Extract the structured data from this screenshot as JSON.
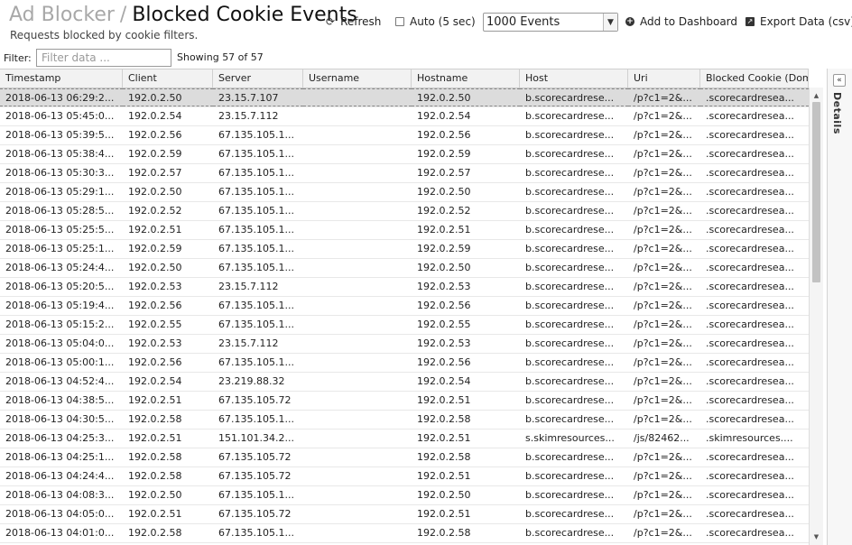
{
  "header": {
    "crumb": "Ad Blocker",
    "separator": "/",
    "title": "Blocked Cookie Events",
    "subtitle": "Requests blocked by cookie filters."
  },
  "toolbar": {
    "refresh_label": "Refresh",
    "auto_label": "Auto (5 sec)",
    "events_selected": "1000 Events",
    "add_dashboard_label": "Add to Dashboard",
    "export_label": "Export Data (csv)"
  },
  "filter": {
    "label": "Filter:",
    "placeholder": "Filter data ...",
    "showing": "Showing 57 of 57"
  },
  "columns": [
    "Timestamp",
    "Client",
    "Server",
    "Username",
    "Hostname",
    "Host",
    "Uri",
    "Blocked Cookie (Domain)"
  ],
  "rows": [
    [
      "2018-06-13 06:29:2...",
      "192.0.2.50",
      "23.15.7.107",
      "",
      "192.0.2.50",
      "b.scorecardrese...",
      "/p?c1=2&...",
      ".scorecardresea..."
    ],
    [
      "2018-06-13 05:45:0...",
      "192.0.2.54",
      "23.15.7.112",
      "",
      "192.0.2.54",
      "b.scorecardrese...",
      "/p?c1=2&...",
      ".scorecardresea..."
    ],
    [
      "2018-06-13 05:39:5...",
      "192.0.2.56",
      "67.135.105.1...",
      "",
      "192.0.2.56",
      "b.scorecardrese...",
      "/p?c1=2&...",
      ".scorecardresea..."
    ],
    [
      "2018-06-13 05:38:4...",
      "192.0.2.59",
      "67.135.105.1...",
      "",
      "192.0.2.59",
      "b.scorecardrese...",
      "/p?c1=2&...",
      ".scorecardresea..."
    ],
    [
      "2018-06-13 05:30:3...",
      "192.0.2.57",
      "67.135.105.1...",
      "",
      "192.0.2.57",
      "b.scorecardrese...",
      "/p?c1=2&...",
      ".scorecardresea..."
    ],
    [
      "2018-06-13 05:29:1...",
      "192.0.2.50",
      "67.135.105.1...",
      "",
      "192.0.2.50",
      "b.scorecardrese...",
      "/p?c1=2&...",
      ".scorecardresea..."
    ],
    [
      "2018-06-13 05:28:5...",
      "192.0.2.52",
      "67.135.105.1...",
      "",
      "192.0.2.52",
      "b.scorecardrese...",
      "/p?c1=2&...",
      ".scorecardresea..."
    ],
    [
      "2018-06-13 05:25:5...",
      "192.0.2.51",
      "67.135.105.1...",
      "",
      "192.0.2.51",
      "b.scorecardrese...",
      "/p?c1=2&...",
      ".scorecardresea..."
    ],
    [
      "2018-06-13 05:25:1...",
      "192.0.2.59",
      "67.135.105.1...",
      "",
      "192.0.2.59",
      "b.scorecardrese...",
      "/p?c1=2&...",
      ".scorecardresea..."
    ],
    [
      "2018-06-13 05:24:4...",
      "192.0.2.50",
      "67.135.105.1...",
      "",
      "192.0.2.50",
      "b.scorecardrese...",
      "/p?c1=2&...",
      ".scorecardresea..."
    ],
    [
      "2018-06-13 05:20:5...",
      "192.0.2.53",
      "23.15.7.112",
      "",
      "192.0.2.53",
      "b.scorecardrese...",
      "/p?c1=2&...",
      ".scorecardresea..."
    ],
    [
      "2018-06-13 05:19:4...",
      "192.0.2.56",
      "67.135.105.1...",
      "",
      "192.0.2.56",
      "b.scorecardrese...",
      "/p?c1=2&...",
      ".scorecardresea..."
    ],
    [
      "2018-06-13 05:15:2...",
      "192.0.2.55",
      "67.135.105.1...",
      "",
      "192.0.2.55",
      "b.scorecardrese...",
      "/p?c1=2&...",
      ".scorecardresea..."
    ],
    [
      "2018-06-13 05:04:0...",
      "192.0.2.53",
      "23.15.7.112",
      "",
      "192.0.2.53",
      "b.scorecardrese...",
      "/p?c1=2&...",
      ".scorecardresea..."
    ],
    [
      "2018-06-13 05:00:1...",
      "192.0.2.56",
      "67.135.105.1...",
      "",
      "192.0.2.56",
      "b.scorecardrese...",
      "/p?c1=2&...",
      ".scorecardresea..."
    ],
    [
      "2018-06-13 04:52:4...",
      "192.0.2.54",
      "23.219.88.32",
      "",
      "192.0.2.54",
      "b.scorecardrese...",
      "/p?c1=2&...",
      ".scorecardresea..."
    ],
    [
      "2018-06-13 04:38:5...",
      "192.0.2.51",
      "67.135.105.72",
      "",
      "192.0.2.51",
      "b.scorecardrese...",
      "/p?c1=2&...",
      ".scorecardresea..."
    ],
    [
      "2018-06-13 04:30:5...",
      "192.0.2.58",
      "67.135.105.1...",
      "",
      "192.0.2.58",
      "b.scorecardrese...",
      "/p?c1=2&...",
      ".scorecardresea..."
    ],
    [
      "2018-06-13 04:25:3...",
      "192.0.2.51",
      "151.101.34.2...",
      "",
      "192.0.2.51",
      "s.skimresources...",
      "/js/82462...",
      ".skimresources...."
    ],
    [
      "2018-06-13 04:25:1...",
      "192.0.2.58",
      "67.135.105.72",
      "",
      "192.0.2.58",
      "b.scorecardrese...",
      "/p?c1=2&...",
      ".scorecardresea..."
    ],
    [
      "2018-06-13 04:24:4...",
      "192.0.2.58",
      "67.135.105.72",
      "",
      "192.0.2.51",
      "b.scorecardrese...",
      "/p?c1=2&...",
      ".scorecardresea..."
    ],
    [
      "2018-06-13 04:08:3...",
      "192.0.2.50",
      "67.135.105.1...",
      "",
      "192.0.2.50",
      "b.scorecardrese...",
      "/p?c1=2&...",
      ".scorecardresea..."
    ],
    [
      "2018-06-13 04:05:0...",
      "192.0.2.51",
      "67.135.105.72",
      "",
      "192.0.2.51",
      "b.scorecardrese...",
      "/p?c1=2&...",
      ".scorecardresea..."
    ],
    [
      "2018-06-13 04:01:0...",
      "192.0.2.58",
      "67.135.105.1...",
      "",
      "192.0.2.58",
      "b.scorecardrese...",
      "/p?c1=2&...",
      ".scorecardresea..."
    ]
  ],
  "details": {
    "label": "Details"
  },
  "icons": {
    "refresh": "refresh-icon",
    "add": "plus-circle-icon",
    "export": "export-icon",
    "collapse": "double-chevron-left-icon"
  }
}
